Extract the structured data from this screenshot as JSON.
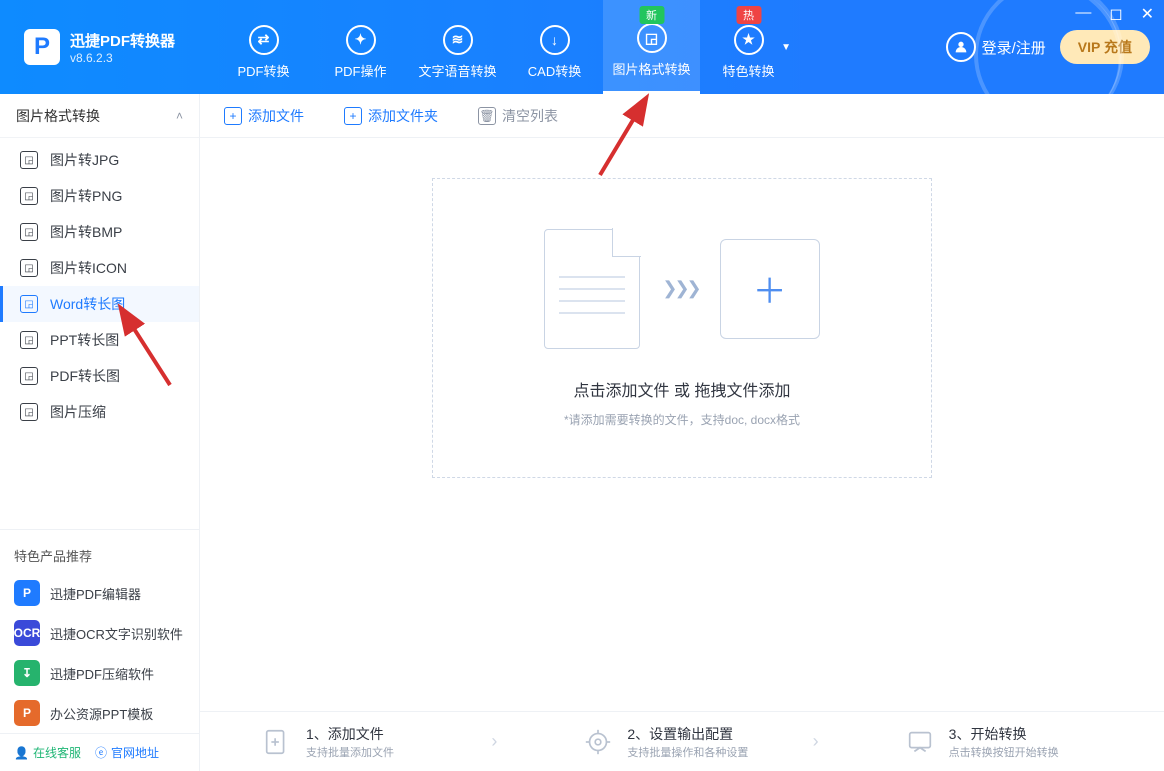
{
  "app": {
    "title": "迅捷PDF转换器",
    "version": "v8.6.2.3"
  },
  "nav": [
    {
      "label": "PDF转换",
      "icon": "⇄"
    },
    {
      "label": "PDF操作",
      "icon": "✦"
    },
    {
      "label": "文字语音转换",
      "icon": "≋"
    },
    {
      "label": "CAD转换",
      "icon": "↓"
    },
    {
      "label": "图片格式转换",
      "icon": "◲",
      "badge": "新",
      "badgeClass": "green",
      "active": true
    },
    {
      "label": "特色转换",
      "icon": "★",
      "badge": "热",
      "badgeClass": "red",
      "caret": true
    }
  ],
  "header": {
    "login": "登录/注册",
    "vip": "VIP 充值"
  },
  "toolbar": {
    "add_file": "添加文件",
    "add_folder": "添加文件夹",
    "clear": "清空列表"
  },
  "sidebar": {
    "category": "图片格式转换",
    "items": [
      {
        "label": "图片转JPG"
      },
      {
        "label": "图片转PNG"
      },
      {
        "label": "图片转BMP"
      },
      {
        "label": "图片转ICON"
      },
      {
        "label": "Word转长图",
        "active": true
      },
      {
        "label": "PPT转长图"
      },
      {
        "label": "PDF转长图"
      },
      {
        "label": "图片压缩"
      }
    ],
    "reco_title": "特色产品推荐",
    "reco": [
      {
        "label": "迅捷PDF编辑器",
        "bg": "#1f7bff",
        "ic": "P"
      },
      {
        "label": "迅捷OCR文字识别软件",
        "bg": "#3a4ad9",
        "ic": "OCR"
      },
      {
        "label": "迅捷PDF压缩软件",
        "bg": "#26b36d",
        "ic": "↧"
      },
      {
        "label": "办公资源PPT模板",
        "bg": "#e56a2b",
        "ic": "P"
      }
    ],
    "bottom": {
      "link1": "在线客服",
      "link2": "官网地址"
    }
  },
  "dropzone": {
    "title": "点击添加文件 或 拖拽文件添加",
    "hint": "*请添加需要转换的文件，支持doc, docx格式"
  },
  "steps": [
    {
      "t": "1、添加文件",
      "s": "支持批量添加文件"
    },
    {
      "t": "2、设置输出配置",
      "s": "支持批量操作和各种设置"
    },
    {
      "t": "3、开始转换",
      "s": "点击转换按钮开始转换"
    }
  ]
}
